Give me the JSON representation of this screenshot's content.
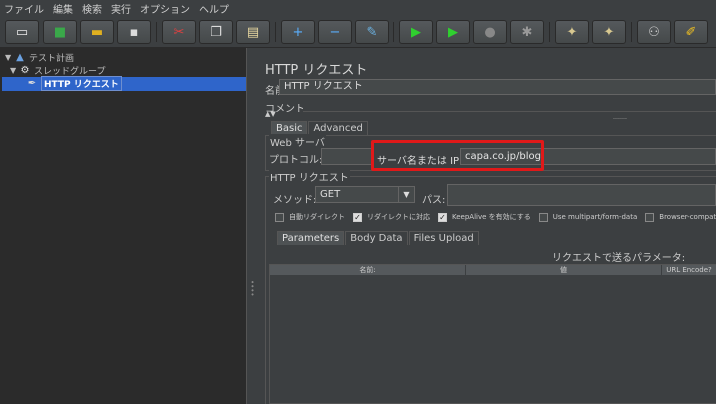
{
  "menu": [
    "ファイル",
    "編集",
    "検索",
    "実行",
    "オプション",
    "ヘルプ"
  ],
  "toolbar": {
    "buttons": [
      {
        "name": "new-icon",
        "glyph": "▭",
        "color": "#e8e8e8"
      },
      {
        "name": "templates-icon",
        "glyph": "■",
        "color": "#3aa84a"
      },
      {
        "name": "open-icon",
        "glyph": "▬",
        "color": "#e0b020"
      },
      {
        "name": "save-icon",
        "glyph": "▪",
        "color": "#dcdcdc"
      },
      {
        "name": "cut-icon",
        "glyph": "✂",
        "color": "#e04040"
      },
      {
        "name": "copy-icon",
        "glyph": "❐",
        "color": "#dcdcdc"
      },
      {
        "name": "paste-icon",
        "glyph": "▤",
        "color": "#e8d8a0"
      },
      {
        "name": "expand-icon",
        "glyph": "+",
        "color": "#5ab0ff"
      },
      {
        "name": "collapse-icon",
        "glyph": "−",
        "color": "#5ab0ff"
      },
      {
        "name": "toggle-icon",
        "glyph": "✎",
        "color": "#6ab0e0"
      },
      {
        "name": "start-icon",
        "glyph": "▶",
        "color": "#2fd02f"
      },
      {
        "name": "start-no-pause-icon",
        "glyph": "▶",
        "color": "#2fd02f"
      },
      {
        "name": "stop-icon",
        "glyph": "●",
        "color": "#888888"
      },
      {
        "name": "shutdown-icon",
        "glyph": "✱",
        "color": "#999999"
      },
      {
        "name": "clear-icon",
        "glyph": "✦",
        "color": "#d8c890"
      },
      {
        "name": "clear-all-icon",
        "glyph": "✦",
        "color": "#d8c890"
      },
      {
        "name": "search-icon",
        "glyph": "⚇",
        "color": "#cccccc"
      },
      {
        "name": "reset-search-icon",
        "glyph": "✐",
        "color": "#f0c020"
      }
    ]
  },
  "tree": {
    "plan": "テスト計画",
    "thread_group": "スレッドグループ",
    "sampler": "HTTP リクエスト"
  },
  "panel": {
    "title": "HTTP リクエスト",
    "name_label": "名前:",
    "name_value": "HTTP リクエスト",
    "comment_label": "コメント:",
    "tab_basic": "Basic",
    "tab_advanced": "Advanced",
    "web_server_legend": "Web サーバ",
    "protocol_label": "プロトコル:",
    "protocol_value": "",
    "server_label": "サーバ名または IP:",
    "server_value": "capa.co.jp/blog",
    "http_legend": "HTTP リクエスト",
    "method_label": "メソッド:",
    "method_value": "GET",
    "path_label": "パス:",
    "path_value": ""
  },
  "checkboxes": [
    {
      "label": "自動リダイレクト",
      "checked": false
    },
    {
      "label": "リダイレクトに対応",
      "checked": true
    },
    {
      "label": "KeepAlive を有効にする",
      "checked": true
    },
    {
      "label": "Use multipart/form-data",
      "checked": false
    },
    {
      "label": "Browser-compat",
      "checked": false
    }
  ],
  "subtabs": {
    "parameters": "Parameters",
    "body": "Body Data",
    "files": "Files Upload"
  },
  "params": {
    "title": "リクエストで送るパラメータ:",
    "columns": [
      "名前:",
      "値",
      "URL Encode?"
    ]
  },
  "colors": {
    "highlight": "#e01919",
    "selection": "#2f65ca"
  }
}
